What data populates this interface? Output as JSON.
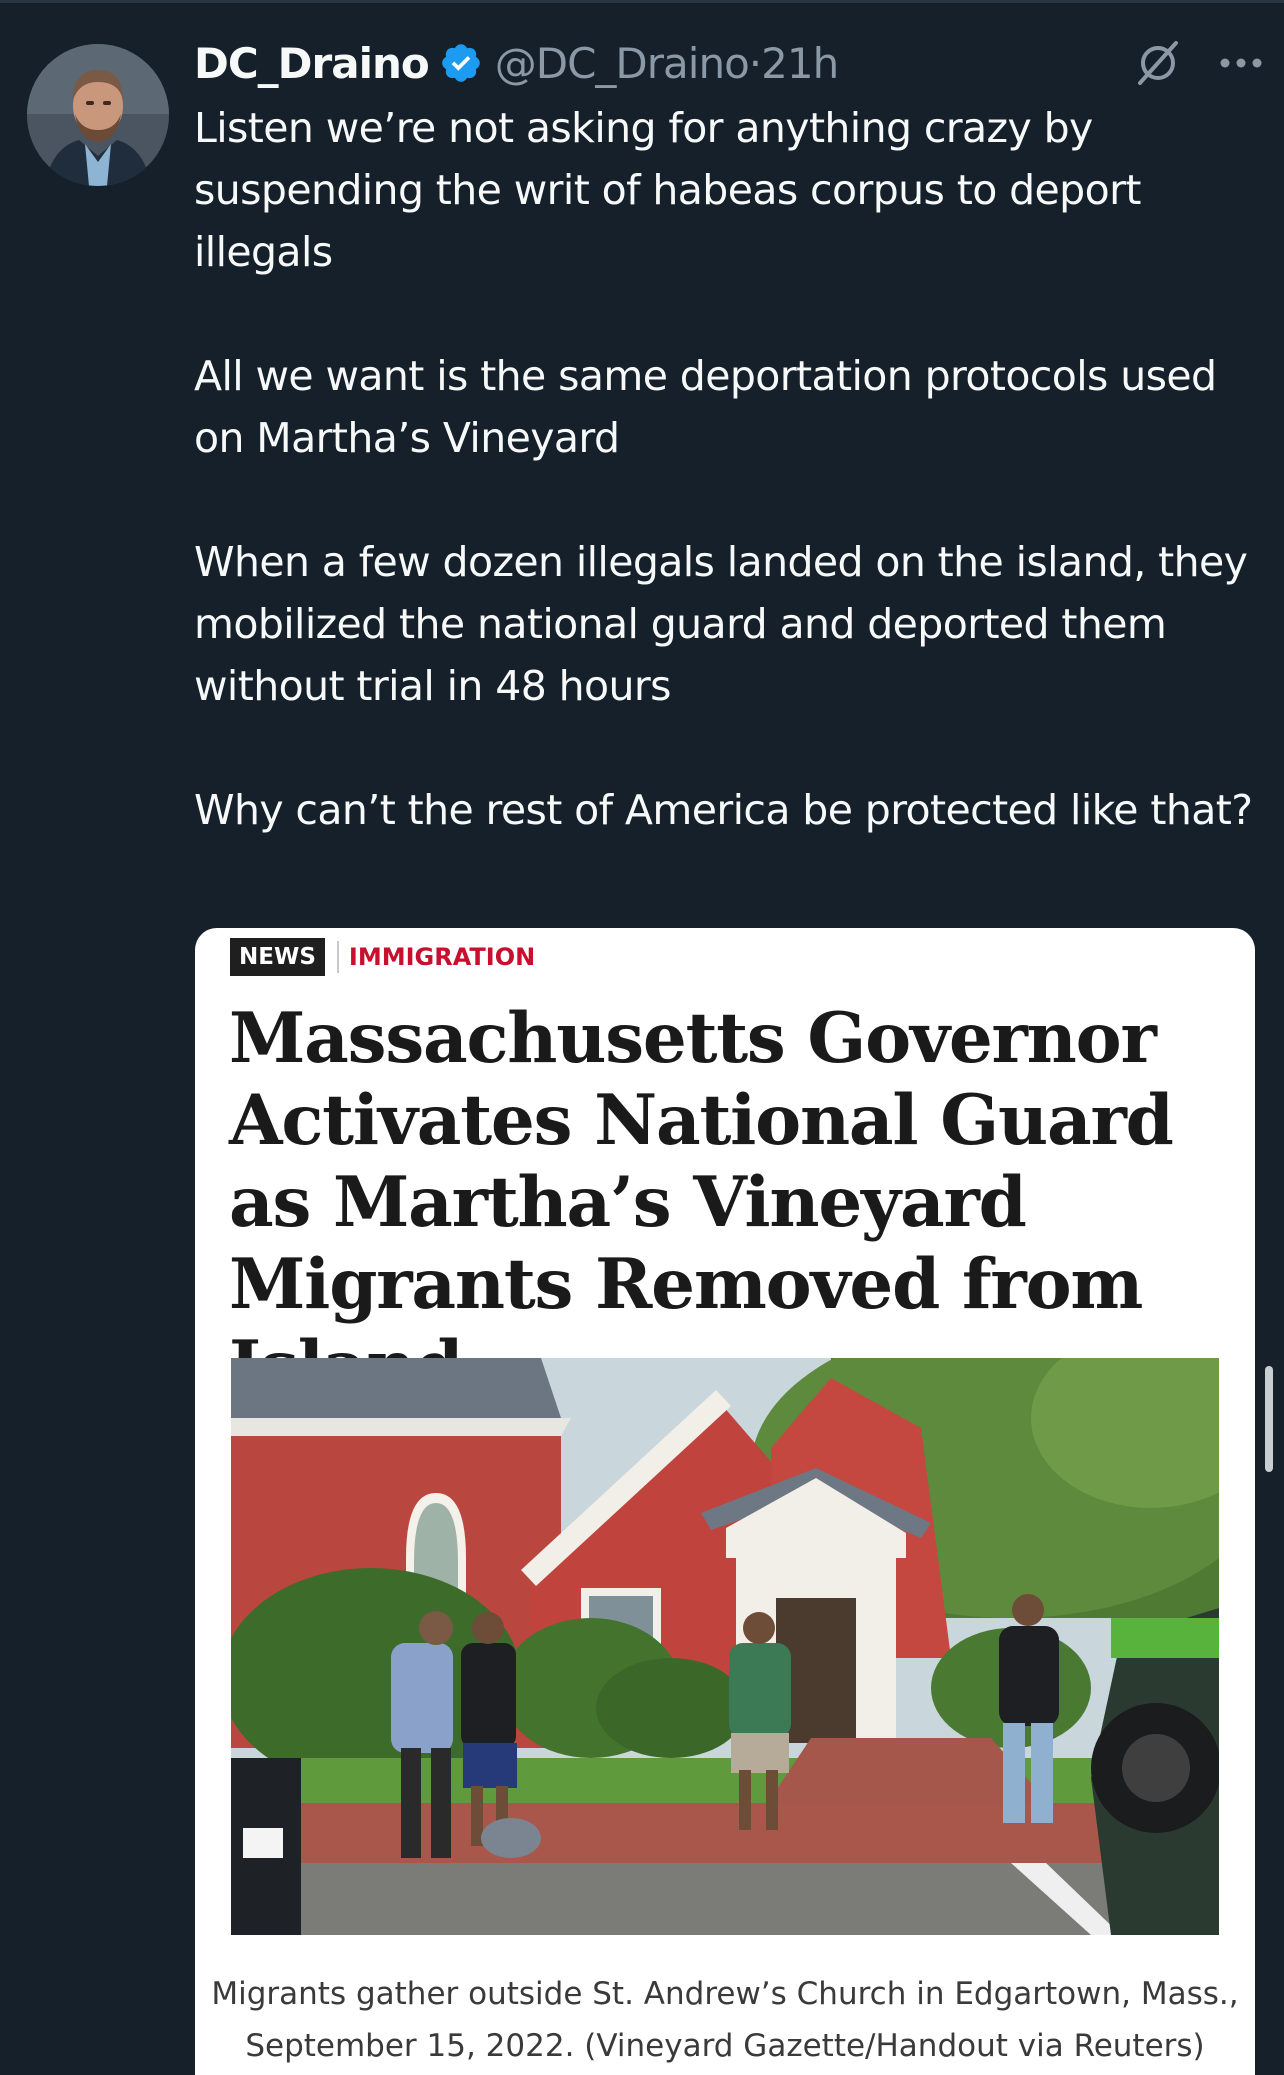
{
  "tweet": {
    "display_name": "DC_Draino",
    "handle": "@DC_Draino",
    "separator": " · ",
    "time": "21h",
    "paragraphs": [
      "Listen we’re not asking for anything crazy by suspending the writ of habeas corpus to deport illegals",
      "All we want is the same deportation protocols used on Martha’s Vineyard",
      "When a few dozen illegals landed on the island, they mobilized the national guard and deported them without trial in 48 hours",
      "Why can’t the rest of America be protected like that?"
    ]
  },
  "article": {
    "tag_news": "NEWS",
    "tag_category": "IMMIGRATION",
    "headline": "Massachusetts Governor Activates National Guard as Martha’s Vineyard Migrants Removed from Island",
    "caption_line1": "Migrants gather outside St. Andrew’s Church in Edgartown, Mass.,",
    "caption_line2": "September 15, 2022. (Vineyard Gazette/Handout via Reuters)"
  },
  "icons": {
    "verified": "verified-badge-icon",
    "grok": "grok-icon",
    "more": "more-options-icon"
  },
  "colors": {
    "background": "#15202b",
    "verified": "#1d9bf0",
    "secondary_text": "#8b98a5",
    "category_red": "#c8102e"
  }
}
